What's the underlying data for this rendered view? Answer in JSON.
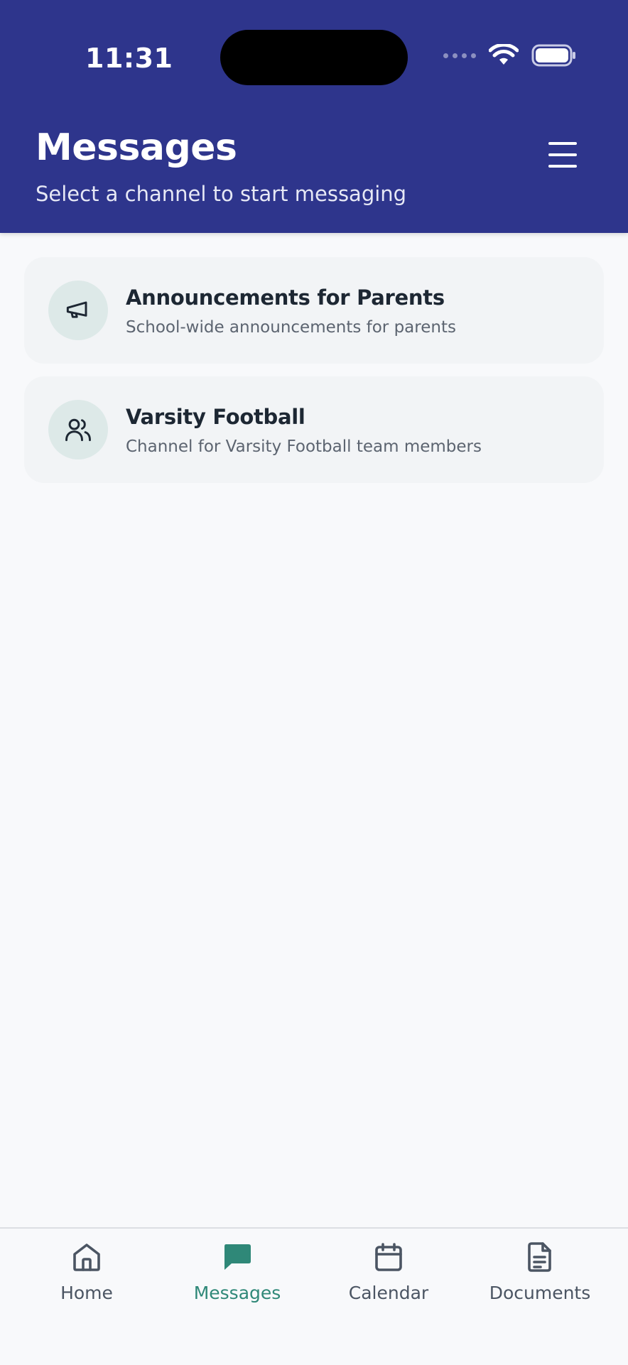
{
  "status_bar": {
    "time": "11:31"
  },
  "header": {
    "title": "Messages",
    "subtitle": "Select a channel to start messaging"
  },
  "channels": [
    {
      "name": "Announcements for Parents",
      "description": "School-wide announcements for parents",
      "icon": "megaphone-icon"
    },
    {
      "name": "Varsity Football",
      "description": "Channel for Varsity Football team members",
      "icon": "users-icon"
    }
  ],
  "bottom_nav": {
    "items": [
      {
        "label": "Home",
        "icon": "home-icon",
        "active": false
      },
      {
        "label": "Messages",
        "icon": "chat-icon",
        "active": true
      },
      {
        "label": "Calendar",
        "icon": "calendar-icon",
        "active": false
      },
      {
        "label": "Documents",
        "icon": "document-icon",
        "active": false
      }
    ]
  },
  "colors": {
    "header_bg": "#2e358c",
    "accent": "#2f8878",
    "page_bg": "#f8f9fb",
    "card_bg": "#f2f4f6",
    "avatar_bg": "#dde9e8"
  }
}
